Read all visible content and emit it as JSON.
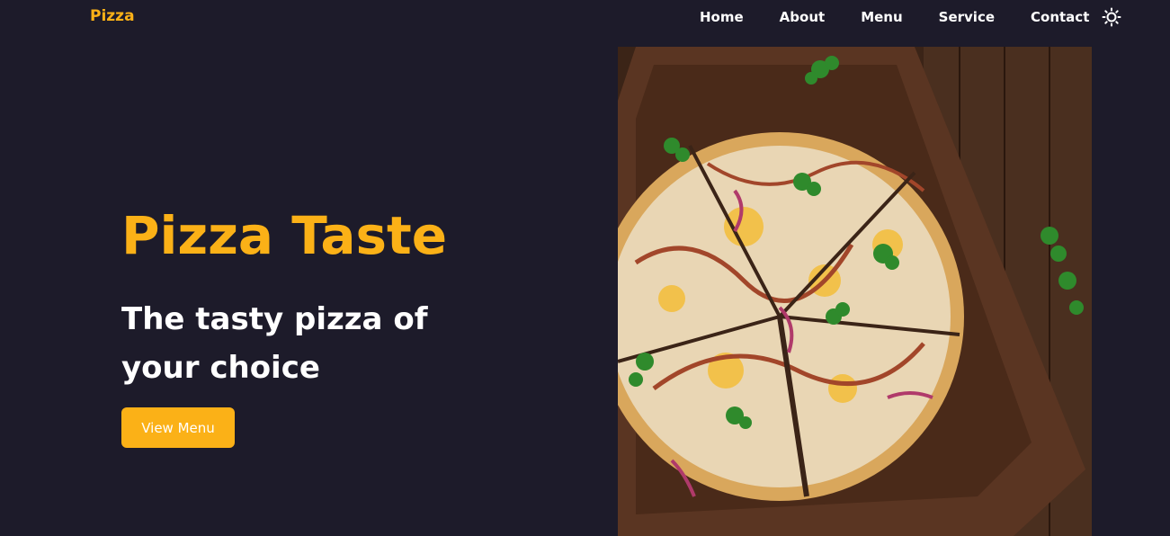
{
  "brand": "Pizza",
  "nav": {
    "links": [
      "Home",
      "About",
      "Menu",
      "Service",
      "Contact"
    ]
  },
  "hero": {
    "title": "Pizza Taste",
    "subtitle": "The tasty pizza of your choice",
    "cta_label": "View Menu"
  },
  "icons": {
    "theme_toggle": "sun-icon"
  },
  "colors": {
    "background": "#1d1b2a",
    "accent": "#fbb117",
    "text": "#ffffff"
  }
}
